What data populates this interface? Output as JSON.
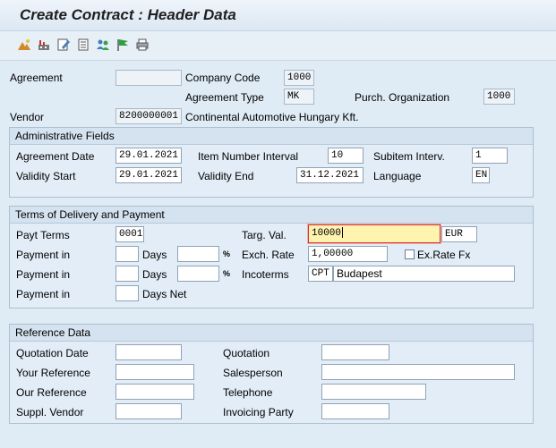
{
  "title": "Create Contract : Header Data",
  "toolbar": {
    "icons": [
      "mountain-icon",
      "factory-icon",
      "edit-icon",
      "document-icon",
      "partners-icon",
      "flag-icon",
      "printer-icon"
    ],
    "accent": "#4a7fb8"
  },
  "header": {
    "agreement_label": "Agreement",
    "agreement_value": "",
    "company_code_label": "Company Code",
    "company_code_value": "1000",
    "agreement_type_label": "Agreement Type",
    "agreement_type_value": "MK",
    "purch_org_label": "Purch. Organization",
    "purch_org_value": "1000",
    "vendor_label": "Vendor",
    "vendor_value": "8200000001",
    "vendor_name": "Continental Automotive Hungary Kft."
  },
  "admin": {
    "heading": "Administrative Fields",
    "agreement_date_label": "Agreement Date",
    "agreement_date_value": "29.01.2021",
    "item_interval_label": "Item Number Interval",
    "item_interval_value": "10",
    "subitem_interval_label": "Subitem Interv.",
    "subitem_interval_value": "1",
    "validity_start_label": "Validity Start",
    "validity_start_value": "29.01.2021",
    "validity_end_label": "Validity End",
    "validity_end_value": "31.12.2021",
    "language_label": "Language",
    "language_value": "EN"
  },
  "terms": {
    "heading": "Terms of Delivery and Payment",
    "payt_terms_label": "Payt Terms",
    "payt_terms_value": "0001",
    "payment_in_label": "Payment in",
    "days_label": "Days",
    "days_net_label": "Days Net",
    "percent_symbol": "%",
    "targ_val_label": "Targ. Val.",
    "targ_val_value": "10000",
    "currency_value": "EUR",
    "exch_rate_label": "Exch. Rate",
    "exch_rate_value": "1,00000",
    "exrate_fx_label": "Ex.Rate Fx",
    "exrate_fx_checked": false,
    "incoterms_label": "Incoterms",
    "incoterms_code": "CPT",
    "incoterms_place": "Budapest"
  },
  "reference": {
    "heading": "Reference Data",
    "quotation_date_label": "Quotation Date",
    "quotation_label": "Quotation",
    "your_reference_label": "Your Reference",
    "salesperson_label": "Salesperson",
    "our_reference_label": "Our Reference",
    "telephone_label": "Telephone",
    "suppl_vendor_label": "Suppl. Vendor",
    "invoicing_party_label": "Invoicing Party"
  }
}
